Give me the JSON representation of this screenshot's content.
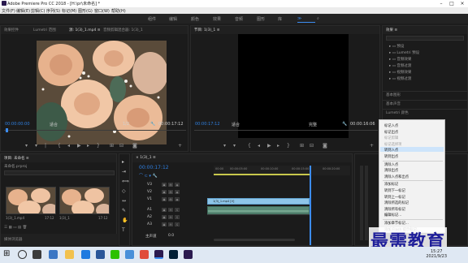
{
  "titlebar": {
    "title": "Adobe Premiere Pro CC 2018 - [H:\\pr\\未命名] *"
  },
  "menu": [
    "文件(F)",
    "编辑(E)",
    "剪辑(C)",
    "序列(S)",
    "标记(M)",
    "图形(G)",
    "窗口(W)",
    "帮助(H)"
  ],
  "workspaces": [
    "组件",
    "编辑",
    "颜色",
    "效果",
    "音频",
    "图形",
    "库"
  ],
  "source": {
    "tabs": [
      "效果控件",
      "Lumetri 范围",
      "源: 1(3)_1.mp4 ≡",
      "音频剪辑混合器: 1(3)_1"
    ],
    "timecode_in": "00:00:00:00",
    "fit": "适合",
    "ratio": "1/2",
    "timecode_dur": "00:00:17:12"
  },
  "program": {
    "tab": "节目: 1(3)_1 ≡",
    "timecode": "00:00:17:12",
    "fit": "适合",
    "quality": "完整",
    "duration": "00:00:16:06"
  },
  "effects": {
    "tab": "效果 ≡",
    "items": [
      "预设",
      "Lumetri 预设",
      "音频效果",
      "音频过渡",
      "视频效果",
      "视频过渡"
    ],
    "sections": [
      "基本图形",
      "基本声音",
      "Lumetri 颜色"
    ]
  },
  "project": {
    "tab": "项目: 未命名 ≡",
    "filename": "未命名.prproj",
    "clips": [
      {
        "label": "1(3)_1.mp4",
        "dur": "17:12"
      },
      {
        "label": "1(3)_1",
        "dur": "17:12"
      }
    ],
    "footer": "媒体浏览器"
  },
  "timeline": {
    "tab": "× 1(3)_1 ≡",
    "timecode": "00:00:17:12",
    "ruler": [
      "00:00",
      "00:00:05:00",
      "00:00:10:00",
      "00:00:15:00",
      "00:00:20:00"
    ],
    "tracks": [
      "V3",
      "V2",
      "V1",
      "A1",
      "A2",
      "A3"
    ],
    "master": "主声道",
    "master_val": "0.0",
    "clip_label": "1(3)_1.mp4 [V]"
  },
  "context_menu": [
    {
      "label": "标记入点",
      "disabled": false
    },
    {
      "label": "标记出点",
      "disabled": false
    },
    {
      "label": "标记剪辑",
      "disabled": true
    },
    {
      "label": "标记选择项",
      "disabled": true
    },
    {
      "label": "转到入点",
      "disabled": false,
      "highlight": true
    },
    {
      "label": "转到出点",
      "disabled": false
    },
    {
      "label": "清除入点",
      "disabled": false,
      "sep": true
    },
    {
      "label": "清除出点",
      "disabled": false
    },
    {
      "label": "清除入点和出点",
      "disabled": false
    },
    {
      "label": "添加标记",
      "disabled": false,
      "sep": true
    },
    {
      "label": "转到下一标记",
      "disabled": false
    },
    {
      "label": "转到上一标记",
      "disabled": false
    },
    {
      "label": "清除所选的标记",
      "disabled": false
    },
    {
      "label": "清除所有标记",
      "disabled": false
    },
    {
      "label": "编辑标记...",
      "disabled": false
    },
    {
      "label": "添加章节标记...",
      "disabled": false,
      "sep": true
    },
    {
      "label": "添加 Flash 提示标记...",
      "disabled": false
    }
  ],
  "watermark": "最需教育",
  "clock": {
    "time": "15:27",
    "date": "2021/9/23"
  }
}
